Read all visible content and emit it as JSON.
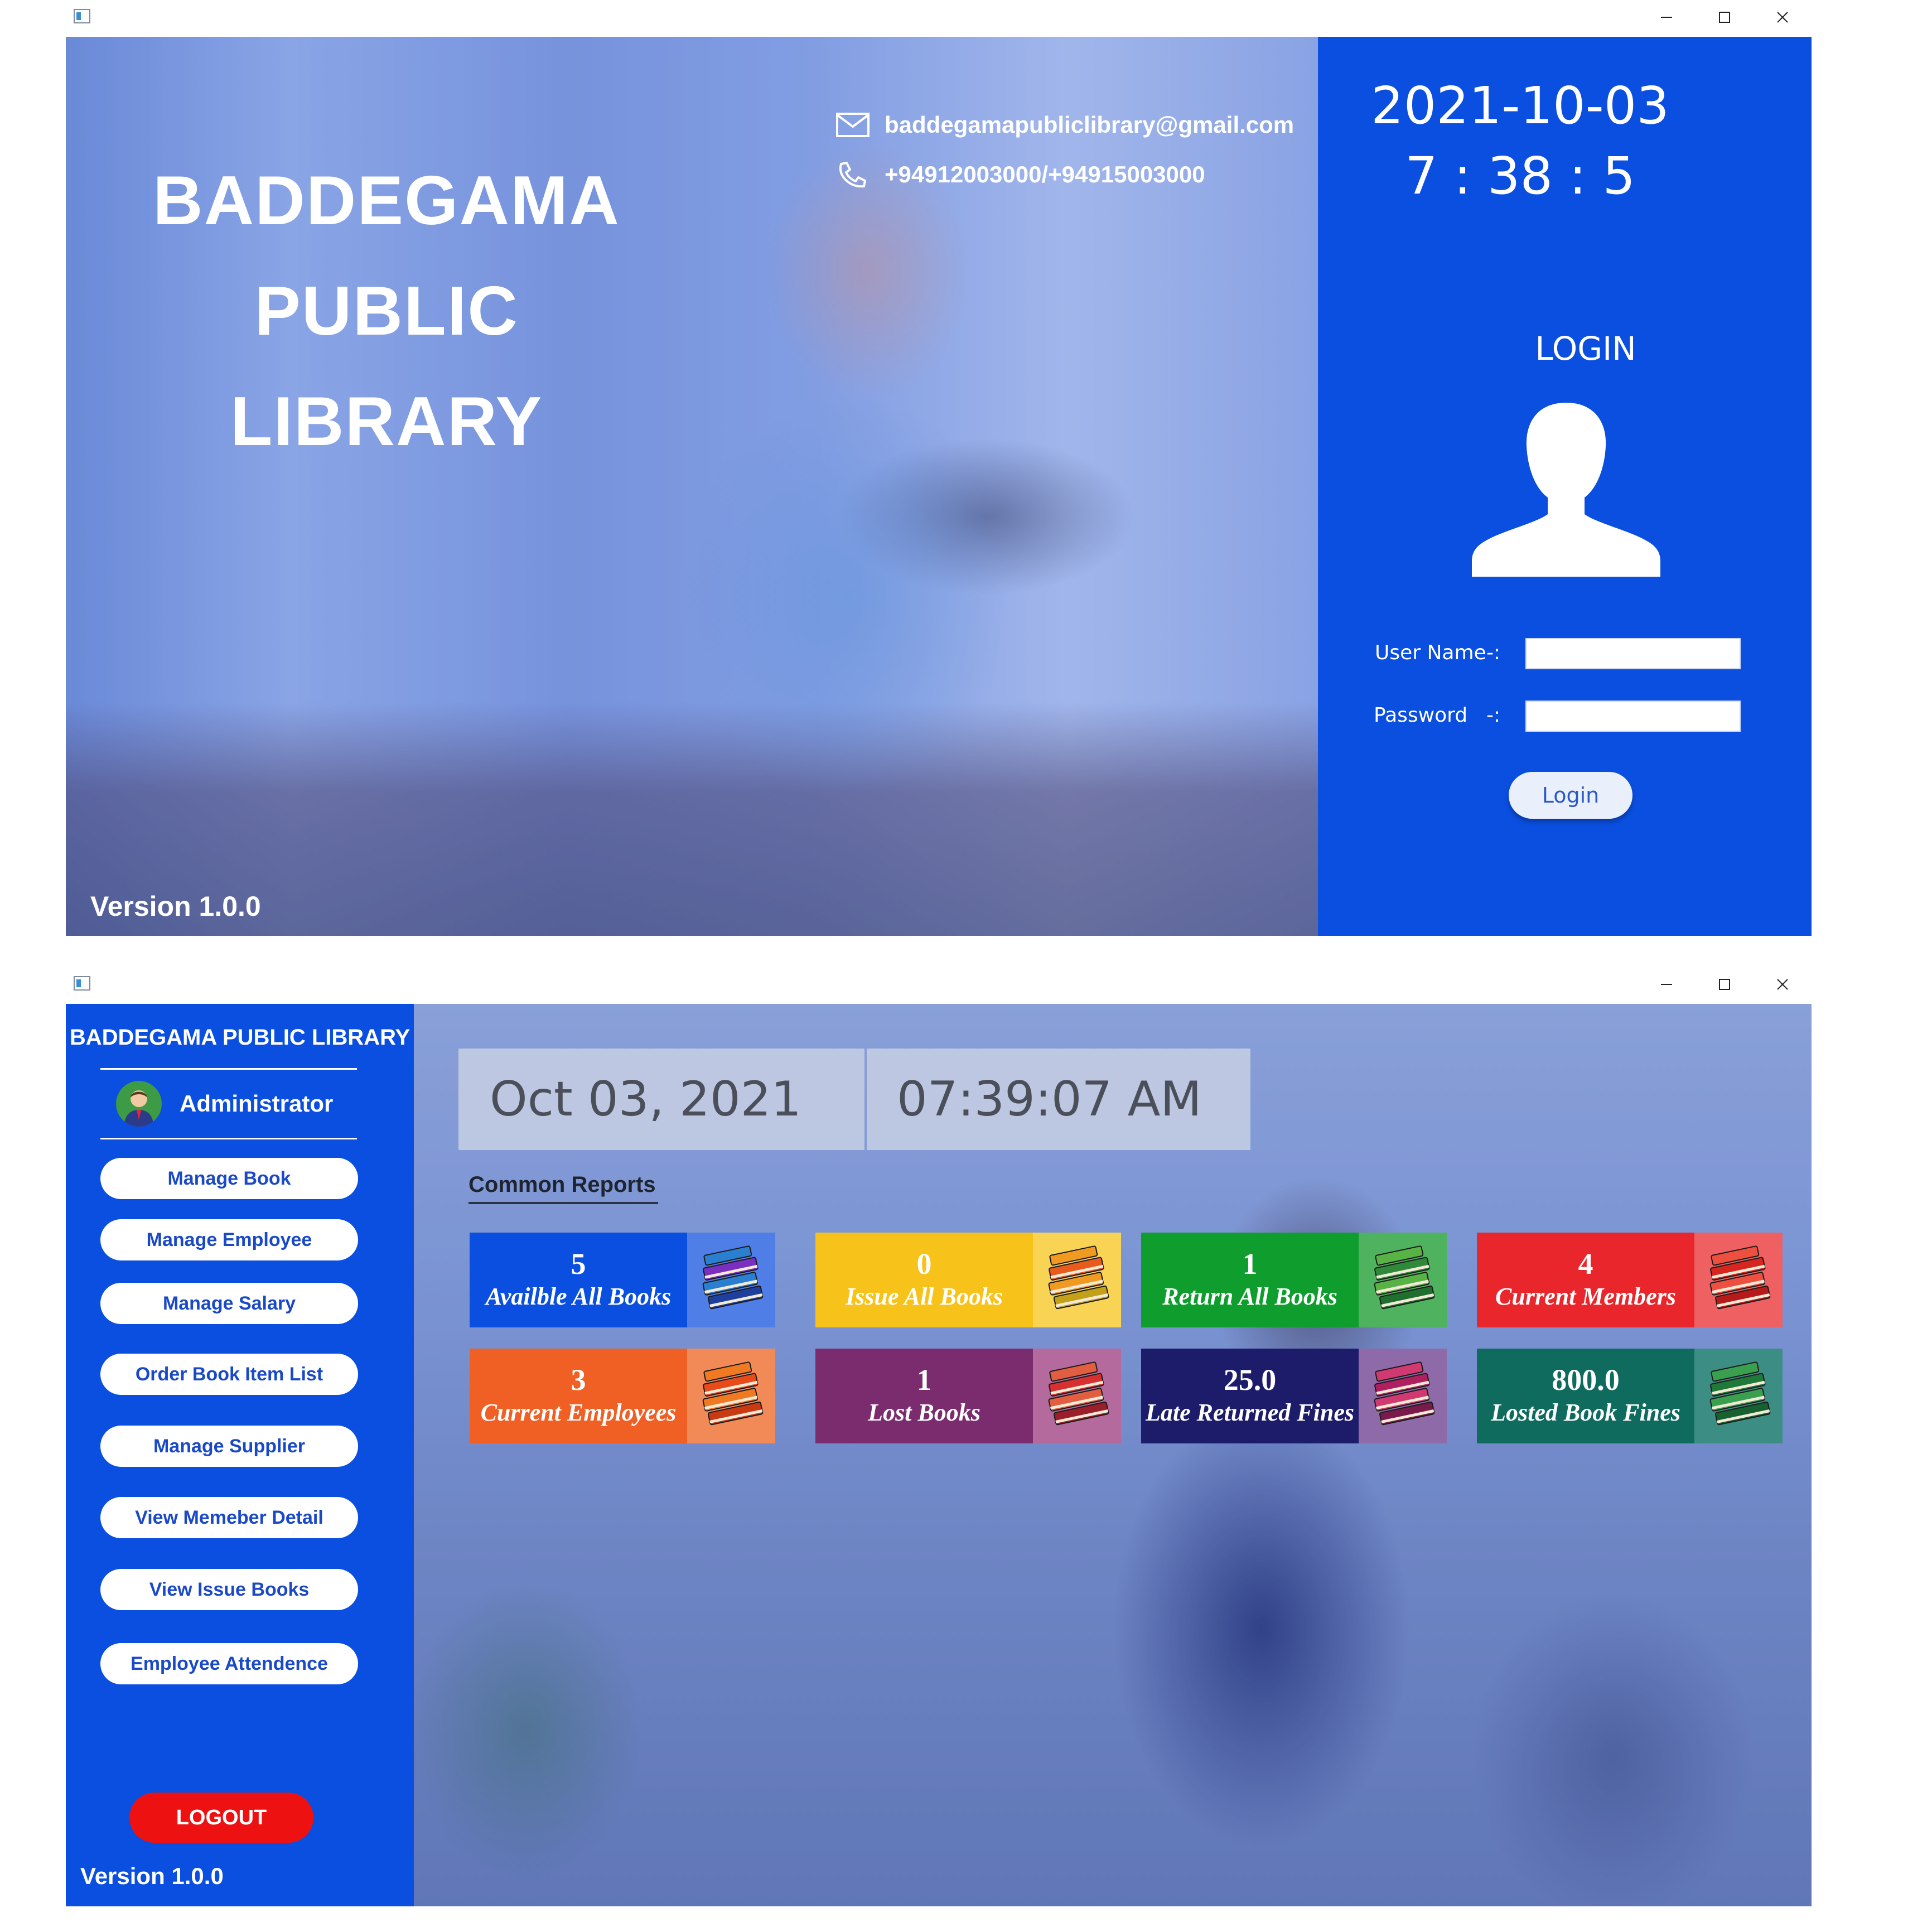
{
  "login_window": {
    "library_name_lines": [
      "BADDEGAMA",
      "PUBLIC",
      "LIBRARY"
    ],
    "email": "baddegamapubliclibrary@gmail.com",
    "phone": "+94912003000/+94915003000",
    "version": "Version 1.0.0",
    "date": "2021-10-03",
    "time": "7 : 38 : 5",
    "login_heading": "LOGIN",
    "username_label": "User Name",
    "password_label": "Password",
    "separator": "-:",
    "username_value": "",
    "password_value": "",
    "login_button": "Login"
  },
  "dashboard_window": {
    "library_name": "BADDEGAMA PUBLIC LIBRARY",
    "user_role": "Administrator",
    "menu": [
      {
        "label": "Manage Book"
      },
      {
        "label": "Manage Employee"
      },
      {
        "label": "Manage Salary"
      },
      {
        "label": "Order Book Item List"
      },
      {
        "label": "Manage Supplier"
      },
      {
        "label": "View Memeber Detail"
      },
      {
        "label": "View Issue Books"
      },
      {
        "label": "Employee Attendence"
      }
    ],
    "logout_button": "LOGOUT",
    "version": "Version 1.0.0",
    "date": "Oct 03, 2021",
    "time": "07:39:07 AM",
    "reports_heading": "Common Reports",
    "cards": [
      {
        "count": "5",
        "label": "Availble All Books",
        "color": "#0a4fe0",
        "icon_bg": "#4f7fe6",
        "book_colors": [
          "#7a2fc0",
          "#2a7fd0",
          "#1f3f9f"
        ]
      },
      {
        "count": "0",
        "label": "Issue All Books",
        "color": "#f7c21a",
        "icon_bg": "#f8d354",
        "book_colors": [
          "#e85b1c",
          "#f19a22",
          "#c2a01a"
        ]
      },
      {
        "count": "1",
        "label": "Return All Books",
        "color": "#0f9e2e",
        "icon_bg": "#4fb25f",
        "book_colors": [
          "#2e8a3a",
          "#57b444",
          "#1f6f2e"
        ]
      },
      {
        "count": "4",
        "label": "Current Members",
        "color": "#e9262b",
        "icon_bg": "#ee6062",
        "book_colors": [
          "#d6261f",
          "#ee5040",
          "#b81a1a"
        ]
      },
      {
        "count": "3",
        "label": "Current Employees",
        "color": "#f06024",
        "icon_bg": "#f28a58",
        "book_colors": [
          "#e84a1a",
          "#f07a22",
          "#c93a12"
        ]
      },
      {
        "count": "1",
        "label": "Lost Books",
        "color": "#7a2c6e",
        "icon_bg": "#b56a9e",
        "book_colors": [
          "#d63030",
          "#e25e40",
          "#9a1f2a"
        ]
      },
      {
        "count": "25.0",
        "label": "Late Returned Fines",
        "color": "#1d1c6a",
        "icon_bg": "#8e6aa8",
        "book_colors": [
          "#b02060",
          "#d03a70",
          "#7a1a4a"
        ]
      },
      {
        "count": "800.0",
        "label": "Losted Book Fines",
        "color": "#0e6b5e",
        "icon_bg": "#3c8e84",
        "book_colors": [
          "#1f7a3a",
          "#3aa050",
          "#176030"
        ]
      }
    ]
  },
  "colors": {
    "brand_blue": "#0a4fe0",
    "logout_red": "#ee1111"
  }
}
